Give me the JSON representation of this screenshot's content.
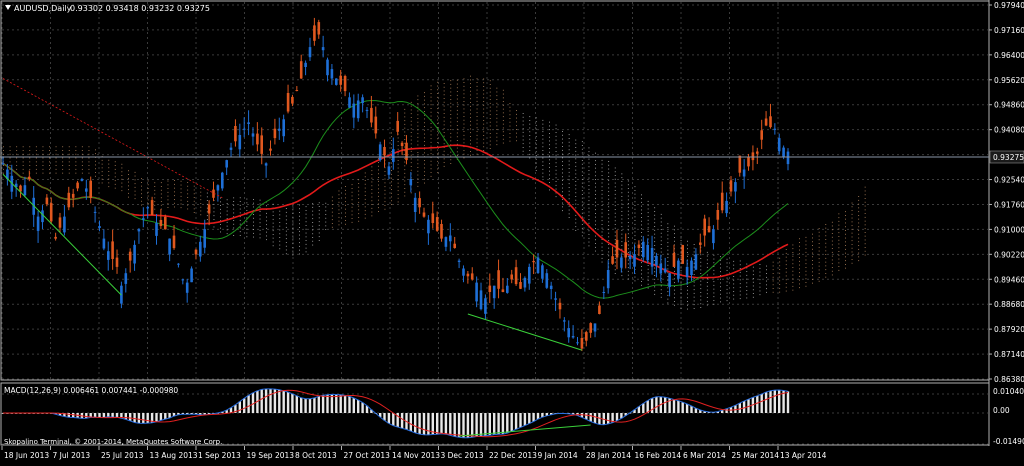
{
  "header": {
    "symbol_timeframe": "AUDUSD,Daily",
    "ohlc": "0.93302 0.93418 0.93232 0.93275"
  },
  "macd": {
    "label": "MACD(12,26,9) 0.006461 0.007441 -0.000980",
    "axis_labels": [
      "0.01040",
      "0.00",
      "-0.01490"
    ]
  },
  "copyright": "Skopalino Terminal, © 2001-2014, MetaQuotes Software Corp.",
  "current_price_tag": "0.93275",
  "colors": {
    "background": "#000000",
    "grid": "#3a3a3a",
    "bull_candle": "#1e6fd6",
    "bear_candle": "#e0581f",
    "sma_red": "#e31a1a",
    "sma_green": "#1c8f1c",
    "kumo_white": "#d8d8d8",
    "kumo_tan": "#d8a070",
    "price_line": "#8a96a8",
    "macd_hist": "#e8e8e8",
    "macd_line": "#2a6fe0",
    "signal_line": "#e02020",
    "divergence": "#3ad03a"
  },
  "chart_data": {
    "type": "candlestick",
    "title": "AUDUSD,Daily",
    "x_tick_labels": [
      "18 Jun 2013",
      "7 Jul 2013",
      "25 Jul 2013",
      "13 Aug 2013",
      "1 Sep 2013",
      "19 Sep 2013",
      "8 Oct 2013",
      "27 Oct 2013",
      "14 Nov 2013",
      "3 Dec 2013",
      "22 Dec 2013",
      "9 Jan 2014",
      "28 Jan 2014",
      "16 Feb 2014",
      "6 Mar 2014",
      "25 Mar 2014",
      "13 Apr 2014"
    ],
    "y_tick_labels": [
      "0.97940",
      "0.97160",
      "0.96400",
      "0.95620",
      "0.94860",
      "0.94080",
      "0.93275",
      "0.92540",
      "0.91760",
      "0.91000",
      "0.90220",
      "0.89460",
      "0.88680",
      "0.87920",
      "0.87140",
      "0.86380"
    ],
    "ylim": [
      0.8638,
      0.9794
    ],
    "close_path": [
      [
        0,
        0.929
      ],
      [
        2,
        0.925
      ],
      [
        4,
        0.92
      ],
      [
        6,
        0.924
      ],
      [
        8,
        0.912
      ],
      [
        10,
        0.916
      ],
      [
        12,
        0.905
      ],
      [
        14,
        0.912
      ],
      [
        16,
        0.918
      ],
      [
        18,
        0.924
      ],
      [
        20,
        0.918
      ],
      [
        22,
        0.909
      ],
      [
        24,
        0.901
      ],
      [
        26,
        0.896
      ],
      [
        27,
        0.89
      ],
      [
        29,
        0.898
      ],
      [
        31,
        0.908
      ],
      [
        33,
        0.915
      ],
      [
        35,
        0.91
      ],
      [
        37,
        0.908
      ],
      [
        39,
        0.902
      ],
      [
        41,
        0.892
      ],
      [
        42,
        0.891
      ],
      [
        44,
        0.9
      ],
      [
        46,
        0.908
      ],
      [
        48,
        0.918
      ],
      [
        50,
        0.926
      ],
      [
        52,
        0.934
      ],
      [
        54,
        0.938
      ],
      [
        56,
        0.942
      ],
      [
        58,
        0.935
      ],
      [
        60,
        0.929
      ],
      [
        62,
        0.937
      ],
      [
        64,
        0.943
      ],
      [
        66,
        0.948
      ],
      [
        68,
        0.956
      ],
      [
        70,
        0.966
      ],
      [
        72,
        0.97
      ],
      [
        74,
        0.962
      ],
      [
        76,
        0.956
      ],
      [
        78,
        0.952
      ],
      [
        80,
        0.948
      ],
      [
        82,
        0.95
      ],
      [
        84,
        0.942
      ],
      [
        86,
        0.935
      ],
      [
        88,
        0.928
      ],
      [
        90,
        0.939
      ],
      [
        92,
        0.93
      ],
      [
        94,
        0.918
      ],
      [
        96,
        0.912
      ],
      [
        98,
        0.91
      ],
      [
        100,
        0.905
      ],
      [
        102,
        0.906
      ],
      [
        104,
        0.898
      ],
      [
        106,
        0.893
      ],
      [
        108,
        0.891
      ],
      [
        110,
        0.886
      ],
      [
        112,
        0.89
      ],
      [
        114,
        0.888
      ],
      [
        116,
        0.892
      ],
      [
        118,
        0.889
      ],
      [
        120,
        0.896
      ],
      [
        122,
        0.899
      ],
      [
        124,
        0.894
      ],
      [
        126,
        0.886
      ],
      [
        128,
        0.879
      ],
      [
        130,
        0.874
      ],
      [
        132,
        0.87
      ],
      [
        134,
        0.875
      ],
      [
        136,
        0.881
      ],
      [
        138,
        0.895
      ],
      [
        140,
        0.899
      ],
      [
        142,
        0.899
      ],
      [
        144,
        0.9
      ],
      [
        146,
        0.904
      ],
      [
        148,
        0.902
      ],
      [
        150,
        0.897
      ],
      [
        152,
        0.894
      ],
      [
        154,
        0.898
      ],
      [
        156,
        0.896
      ],
      [
        158,
        0.9
      ],
      [
        160,
        0.906
      ],
      [
        162,
        0.908
      ],
      [
        164,
        0.914
      ],
      [
        166,
        0.92
      ],
      [
        168,
        0.926
      ],
      [
        170,
        0.928
      ],
      [
        172,
        0.932
      ],
      [
        174,
        0.941
      ],
      [
        176,
        0.94
      ],
      [
        178,
        0.934
      ],
      [
        179,
        0.9327
      ]
    ],
    "series": [
      {
        "name": "MACD(12,26,9)",
        "last_values": [
          0.006461,
          0.007441,
          -0.00098
        ]
      }
    ]
  }
}
